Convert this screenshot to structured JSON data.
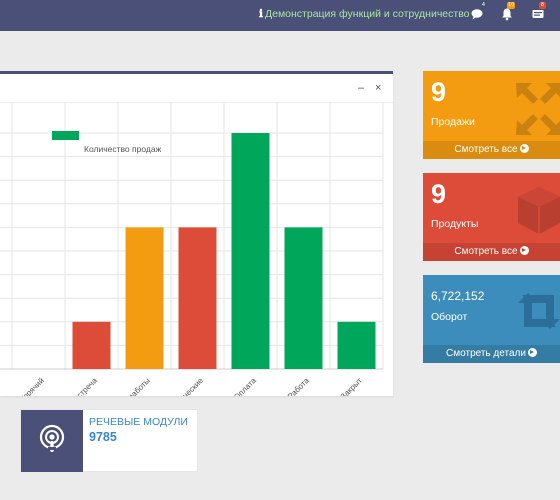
{
  "topbar": {
    "demo_link": "Демонстрация функций и сотрудничество",
    "badges": {
      "messages": "4",
      "notifications": "10",
      "tasks": "8"
    }
  },
  "panel": {
    "minimize_label": "–",
    "close_label": "×"
  },
  "chart_data": {
    "type": "bar",
    "legend": [
      "Количество продаж"
    ],
    "legend_position": "top",
    "categories": [
      "Горячий",
      "Встреча",
      "Тестовые работы",
      "Коммерческие",
      "Оплата",
      "Работа",
      "Закрыт"
    ],
    "values": [
      0,
      1,
      3,
      3,
      5,
      3,
      1
    ],
    "colors": [
      "#00a65a",
      "#dd4b39",
      "#f39c12",
      "#dd4b39",
      "#00a65a",
      "#00a65a",
      "#00a65a"
    ],
    "ylim": [
      0,
      5
    ],
    "grid": true
  },
  "stats": [
    {
      "number": "9",
      "label": "Продажи",
      "footer": "Смотреть все",
      "color": "#f39c12",
      "footer_color": "#da8c10",
      "icon": "arrows-alt-icon"
    },
    {
      "number": "9",
      "label": "Продукты",
      "footer": "Смотреть все",
      "color": "#dd4b39",
      "footer_color": "#c64333",
      "icon": "cube-icon"
    },
    {
      "number": "6,722,152",
      "label": "Оборот",
      "footer": "Смотреть детали",
      "color": "#3c8dbc",
      "footer_color": "#357ca5",
      "icon": "retweet-icon"
    }
  ],
  "voice": {
    "label": "Речевые модули",
    "value": "9785",
    "icon": "podcast-icon"
  }
}
